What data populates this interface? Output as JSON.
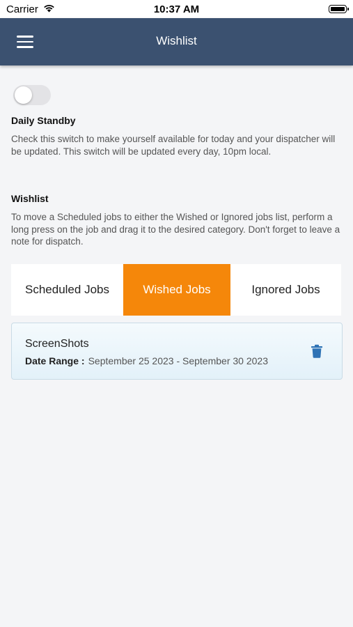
{
  "status_bar": {
    "carrier": "Carrier",
    "time": "10:37 AM"
  },
  "nav": {
    "title": "Wishlist",
    "menu_icon": "hamburger-menu-icon"
  },
  "standby": {
    "toggle_on": false,
    "title": "Daily Standby",
    "description": "Check this switch to make yourself available for today and your dispatcher will be updated. This switch will be updated every day, 10pm local."
  },
  "wishlist": {
    "title": "Wishlist",
    "description": "To move a Scheduled jobs to either the Wished or Ignored jobs list, perform a long press on the job and drag it to the desired category. Don't forget to leave a note for dispatch."
  },
  "tabs": [
    {
      "label": "Scheduled Jobs",
      "active": false
    },
    {
      "label": "Wished Jobs",
      "active": true
    },
    {
      "label": "Ignored Jobs",
      "active": false
    }
  ],
  "jobs": [
    {
      "name": "ScreenShots",
      "date_range_label": "Date Range :",
      "date_range": "September 25 2023 - September 30 2023",
      "action_icon": "trash-icon"
    }
  ],
  "colors": {
    "nav_bg": "#3b5170",
    "active_tab": "#f5870a",
    "trash_icon": "#2f73b5"
  }
}
